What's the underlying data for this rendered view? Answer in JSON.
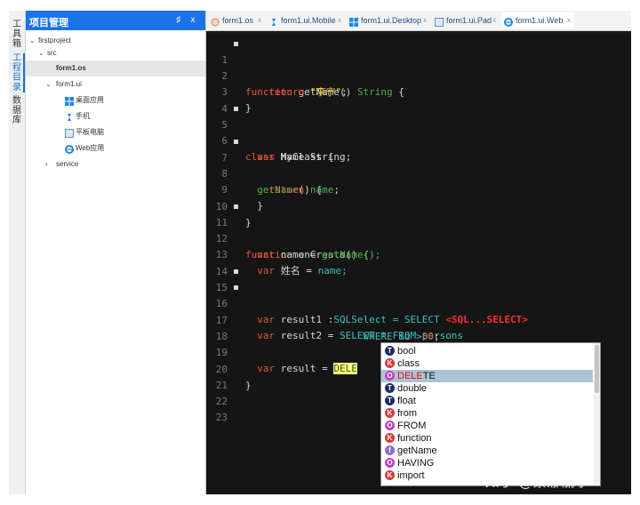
{
  "toolstrip": {
    "tabs": [
      "工具箱",
      "工程目录",
      "数据库"
    ]
  },
  "panel": {
    "title": "项目管理",
    "pin_label": "♯",
    "close_label": "x",
    "tree": {
      "root": "firstproject",
      "src": "src",
      "form1_os": "form1.os",
      "form1_ui": "form1.ui",
      "desktop": "桌面应用",
      "mobile": "手机",
      "pad": "平板电脑",
      "web": "Web应用",
      "service": "service"
    }
  },
  "tabs": [
    {
      "label": "form1.os",
      "icon": "os-icon"
    },
    {
      "label": "form1.ui.Mobile",
      "icon": "mobile-icon"
    },
    {
      "label": "form1.ui.Desktop",
      "icon": "windows-icon"
    },
    {
      "label": "form1.ui.Pad",
      "icon": "pad-icon"
    },
    {
      "label": "form1.ui.Web",
      "icon": "ie-icon"
    }
  ],
  "tab_close": "x",
  "editor": {
    "line_numbers": [
      "1",
      "2",
      "3",
      "4",
      "5",
      "6",
      "7",
      "8",
      "9",
      "10",
      "11",
      "12",
      "13",
      "14",
      "15",
      "16",
      "17",
      "18",
      "19",
      "20",
      "21",
      "22",
      "23"
    ],
    "tokens": {
      "function": "function",
      "getName": "getName",
      "getName_call": "getName()",
      "String": "String",
      "open_brace": "{",
      "close_brace": "}",
      "return": "return",
      "str_lining": "\"李宁\"",
      "semicolon": ";",
      "class": "class",
      "MyClass": "MyClass",
      "var": "var",
      "name_string": "name String;",
      "name": "name",
      "eq": " = ",
      "getName_call_semi": "getName();",
      "xingming": "姓名",
      "name_semi": "name;",
      "onCreate": "onCreate()",
      "result1": "result1 :",
      "SQLSelect": "SQLSelect = SELECT ",
      "sqlfrag": "<SQL...SELECT>",
      "result2": "result2 =",
      "select_star": " SELECT * FROM persons",
      "where": "WHERE id >",
      "num30": "30",
      "result": "result = ",
      "dele": "DELE"
    }
  },
  "autocomplete": {
    "items": [
      {
        "label": "bool",
        "kind": "T",
        "color": "#1e2e5e"
      },
      {
        "label": "class",
        "kind": "K",
        "color": "#d93a3a"
      },
      {
        "label_match": "DELE",
        "label_rest": "TE",
        "kind": "O",
        "color": "#c43fc4",
        "selected": true
      },
      {
        "label": "double",
        "kind": "T",
        "color": "#1e2e5e"
      },
      {
        "label": "float",
        "kind": "T",
        "color": "#1e2e5e"
      },
      {
        "label": "from",
        "kind": "K",
        "color": "#d93a3a"
      },
      {
        "label": "FROM",
        "kind": "O",
        "color": "#c43fc4"
      },
      {
        "label": "function",
        "kind": "K",
        "color": "#d93a3a"
      },
      {
        "label": "getName",
        "kind": "f",
        "color": "#8a6fd0"
      },
      {
        "label": "HAVING",
        "kind": "O",
        "color": "#c43fc4"
      },
      {
        "label": "import",
        "kind": "K",
        "color": "#d93a3a"
      }
    ]
  },
  "watermark": "知乎 @蒙娜丽宁"
}
